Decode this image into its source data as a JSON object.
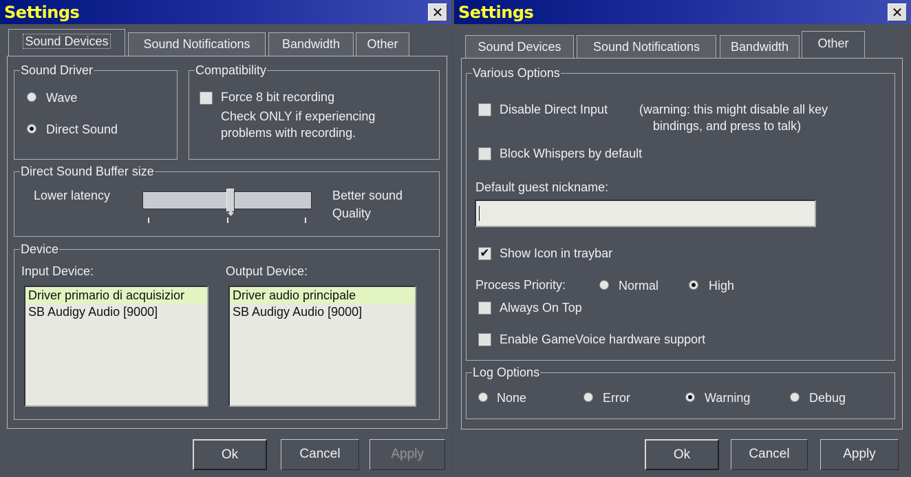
{
  "left": {
    "title": "Settings",
    "close": "✕",
    "tabs": [
      "Sound Devices",
      "Sound Notifications",
      "Bandwidth",
      "Other"
    ],
    "active_tab": "Sound Devices",
    "sound_driver": {
      "legend": "Sound Driver",
      "options": [
        "Wave",
        "Direct Sound"
      ],
      "selected": "Direct Sound"
    },
    "compatibility": {
      "legend": "Compatibility",
      "force8": "Force 8 bit recording",
      "force8_checked": false,
      "note_line1": "Check ONLY if experiencing",
      "note_line2": "problems with recording."
    },
    "buffer": {
      "legend": "Direct Sound Buffer size",
      "low_label": "Lower latency",
      "high_label_1": "Better sound",
      "high_label_2": "Quality",
      "value_fraction": 0.52
    },
    "device": {
      "legend": "Device",
      "input_label": "Input Device:",
      "output_label": "Output Device:",
      "input_items": [
        "Driver primario di acquisizior",
        "SB Audigy Audio [9000]"
      ],
      "input_selected": 0,
      "output_items": [
        "Driver audio principale",
        "SB Audigy Audio [9000]"
      ],
      "output_selected": 0
    },
    "buttons": {
      "ok": "Ok",
      "cancel": "Cancel",
      "apply": "Apply"
    }
  },
  "right": {
    "title": "Settings",
    "close": "✕",
    "tabs": [
      "Sound Devices",
      "Sound Notifications",
      "Bandwidth",
      "Other"
    ],
    "active_tab": "Other",
    "various": {
      "legend": "Various Options",
      "disable_direct_input": "Disable Direct Input",
      "disable_direct_input_checked": false,
      "warning_line1": "(warning: this might disable all key",
      "warning_line2": "bindings, and press to talk)",
      "block_whispers": "Block Whispers by default",
      "block_whispers_checked": false,
      "guest_label": "Default guest nickname:",
      "guest_value": "",
      "show_icon": "Show Icon in traybar",
      "show_icon_checked": true,
      "priority_label": "Process Priority:",
      "priority_options": [
        "Normal",
        "High"
      ],
      "priority_selected": "High",
      "always_on_top": "Always On Top",
      "always_on_top_checked": false,
      "gamevoice": "Enable GameVoice hardware support",
      "gamevoice_checked": false
    },
    "log": {
      "legend": "Log Options",
      "options": [
        "None",
        "Error",
        "Warning",
        "Debug"
      ],
      "selected": "Warning"
    },
    "buttons": {
      "ok": "Ok",
      "cancel": "Cancel",
      "apply": "Apply"
    }
  },
  "colors": {
    "title_text": "#ffff30",
    "titlebar": "#00157e",
    "background": "#4d5159",
    "list_selected": "#e2f5c0"
  }
}
